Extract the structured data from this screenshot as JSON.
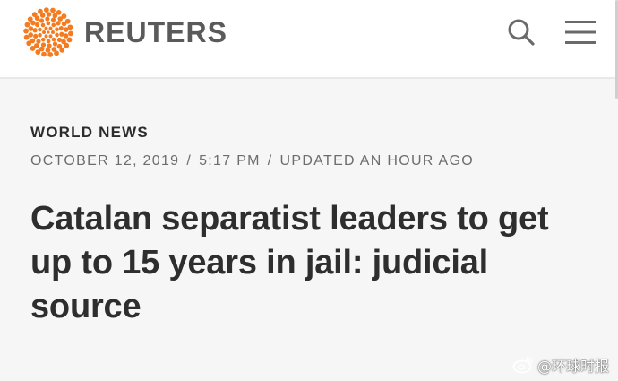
{
  "header": {
    "brand": "REUTERS",
    "brand_color": "#f47b20",
    "icons": {
      "search": "search-icon",
      "menu": "hamburger-menu-icon"
    }
  },
  "article": {
    "section": "WORLD NEWS",
    "date": "OCTOBER 12, 2019",
    "time": "5:17 PM",
    "updated": "UPDATED AN HOUR AGO",
    "separator": "/",
    "headline": "Catalan separatist leaders to get up to 15 years in jail: judicial source"
  },
  "watermark": {
    "text": "@环球时报",
    "icon": "weibo-icon"
  }
}
